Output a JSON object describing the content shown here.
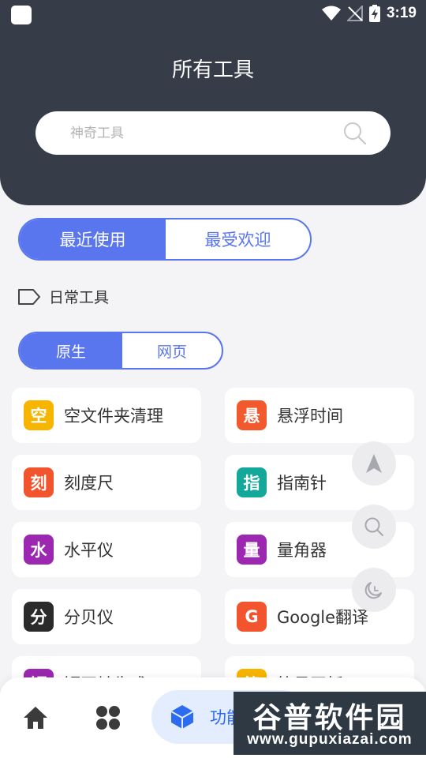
{
  "status_bar": {
    "time": "3:19"
  },
  "header": {
    "title": "所有工具"
  },
  "search": {
    "placeholder": "神奇工具"
  },
  "sort_tabs": [
    {
      "label": "最近使用",
      "selected": true
    },
    {
      "label": "最受欢迎",
      "selected": false
    }
  ],
  "section": {
    "label": "日常工具"
  },
  "type_tabs": [
    {
      "label": "原生",
      "selected": true
    },
    {
      "label": "网页",
      "selected": false
    }
  ],
  "tools": [
    {
      "badge": "空",
      "label": "空文件夹清理",
      "color": "#f7b500"
    },
    {
      "badge": "悬",
      "label": "悬浮时间",
      "color": "#f25a2d"
    },
    {
      "badge": "刻",
      "label": "刻度尺",
      "color": "#f2542d"
    },
    {
      "badge": "指",
      "label": "指南针",
      "color": "#14a89a"
    },
    {
      "badge": "水",
      "label": "水平仪",
      "color": "#9c27b0"
    },
    {
      "badge": "量",
      "label": "量角器",
      "color": "#9c27b0"
    },
    {
      "badge": "分",
      "label": "分贝仪",
      "color": "#2b2b2b"
    },
    {
      "badge": "G",
      "label": "Google翻译",
      "color": "#f2542d"
    },
    {
      "badge": "短",
      "label": "短网址生成",
      "color": "#9c27b0"
    },
    {
      "badge": "简",
      "label": "简易画板",
      "color": "#f7b500"
    }
  ],
  "floating_buttons": [
    "navigation-arrow-icon",
    "search-icon",
    "night-mode-icon"
  ],
  "bottom_nav": {
    "home_icon": "home-icon",
    "apps_icon": "apps-icon",
    "active_label": "功能"
  },
  "watermark": {
    "title": "谷普软件园",
    "url": "www.gupuxiazai.com"
  },
  "colors": {
    "accent": "#5a76ef",
    "header_bg": "#363c48",
    "nav_active": "#2d6cf0"
  }
}
